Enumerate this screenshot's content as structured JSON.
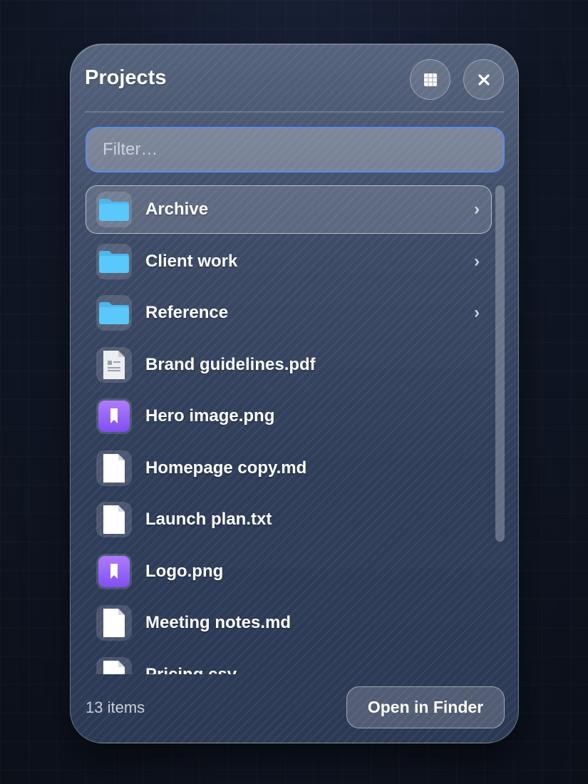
{
  "panel": {
    "title": "Projects",
    "grid_button_icon": "grid-icon",
    "close_button_icon": "close-icon"
  },
  "filter": {
    "placeholder": "Filter…",
    "value": ""
  },
  "items": [
    {
      "label": "Archive",
      "kind": "folder",
      "icon": "folder-icon",
      "has_chevron": true,
      "selected": true
    },
    {
      "label": "Client work",
      "kind": "folder",
      "icon": "folder-icon",
      "has_chevron": true,
      "selected": false
    },
    {
      "label": "Reference",
      "kind": "folder",
      "icon": "folder-icon",
      "has_chevron": true,
      "selected": false
    },
    {
      "label": "Brand guidelines.pdf",
      "kind": "pdf",
      "icon": "pdf-file-icon",
      "has_chevron": false,
      "selected": false
    },
    {
      "label": "Hero image.png",
      "kind": "image",
      "icon": "image-file-icon",
      "has_chevron": false,
      "selected": false
    },
    {
      "label": "Homepage copy.md",
      "kind": "doc",
      "icon": "document-icon",
      "has_chevron": false,
      "selected": false
    },
    {
      "label": "Launch plan.txt",
      "kind": "doc",
      "icon": "document-icon",
      "has_chevron": false,
      "selected": false
    },
    {
      "label": "Logo.png",
      "kind": "image",
      "icon": "image-file-icon",
      "has_chevron": false,
      "selected": false
    },
    {
      "label": "Meeting notes.md",
      "kind": "doc",
      "icon": "document-icon",
      "has_chevron": false,
      "selected": false
    },
    {
      "label": "Pricing.csv",
      "kind": "doc",
      "icon": "document-icon",
      "has_chevron": false,
      "selected": false
    }
  ],
  "chevron": "›",
  "footer": {
    "count": "13 items",
    "open_button": "Open in Finder"
  },
  "colors": {
    "folder": "#5ac8fa",
    "image": "#9b6cf6",
    "accent_focus": "#5b8def"
  }
}
